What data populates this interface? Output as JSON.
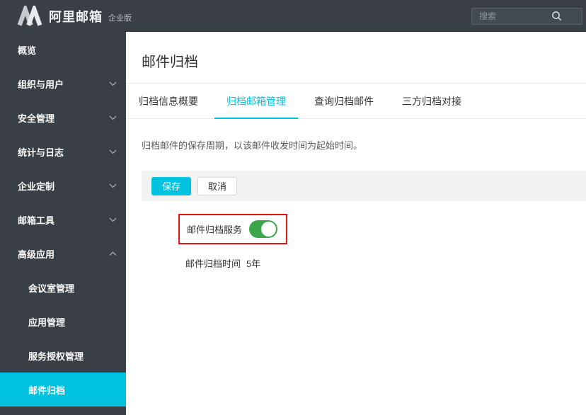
{
  "topbar": {
    "brand": "阿里邮箱",
    "badge": "企业版",
    "search_placeholder": "搜索"
  },
  "sidebar": {
    "items": [
      {
        "label": "概览",
        "chevron": "none"
      },
      {
        "label": "组织与用户",
        "chevron": "down"
      },
      {
        "label": "安全管理",
        "chevron": "down"
      },
      {
        "label": "统计与日志",
        "chevron": "down"
      },
      {
        "label": "企业定制",
        "chevron": "down"
      },
      {
        "label": "邮箱工具",
        "chevron": "down"
      },
      {
        "label": "高级应用",
        "chevron": "up"
      }
    ],
    "subitems": [
      {
        "label": "会议室管理",
        "active": false
      },
      {
        "label": "应用管理",
        "active": false
      },
      {
        "label": "服务授权管理",
        "active": false
      },
      {
        "label": "邮件归档",
        "active": true
      }
    ]
  },
  "main": {
    "title": "邮件归档",
    "tabs": [
      {
        "label": "归档信息概要",
        "active": false
      },
      {
        "label": "归档邮箱管理",
        "active": true
      },
      {
        "label": "查询归档邮件",
        "active": false
      },
      {
        "label": "三方归档对接",
        "active": false
      }
    ],
    "description": "归档邮件的保存周期，以该邮件收发时间为起始时间。",
    "toolbar": {
      "save_label": "保存",
      "cancel_label": "取消"
    },
    "service_row": {
      "label": "邮件归档服务",
      "toggle_state": "on"
    },
    "time_row": {
      "label": "邮件归档时间",
      "value": "5年"
    }
  },
  "colors": {
    "accent": "#00c1de",
    "chrome_dark": "#393f45",
    "toggle_on": "#3ca64a",
    "annotation_red": "#ee1010",
    "toolbar_strip": "#f2f2f2"
  }
}
